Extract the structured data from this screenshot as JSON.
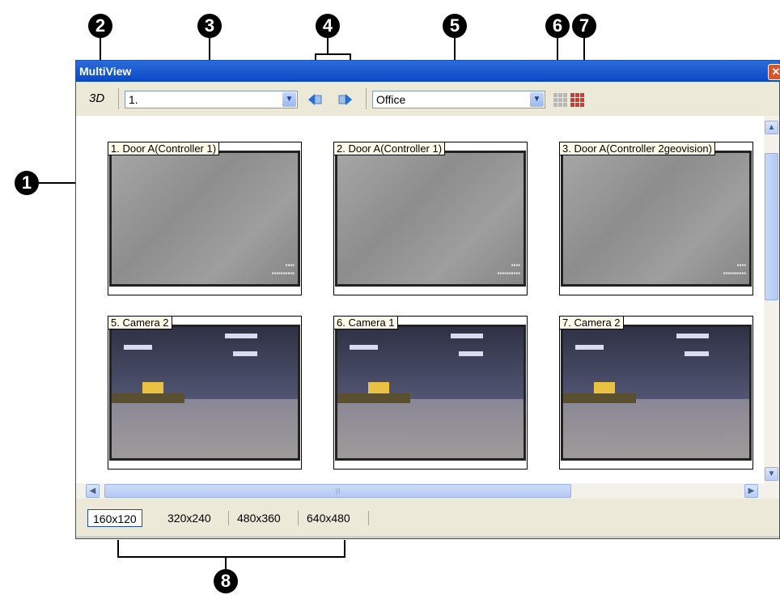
{
  "window": {
    "title": "MultiView",
    "close_glyph": "✕"
  },
  "toolbar": {
    "btn_3d_label": "3D",
    "camera_combo_value": "1.",
    "group_combo_value": "Office",
    "icons": [
      "prev-page-icon",
      "next-page-icon",
      "layout-grid-icon",
      "close-all-icon"
    ]
  },
  "tiles": [
    {
      "label": "1. Door A(Controller 1)",
      "scene": "door"
    },
    {
      "label": "2. Door A(Controller 1)",
      "scene": "door"
    },
    {
      "label": "3. Door A(Controller 2geovision)",
      "scene": "door"
    },
    {
      "label": "5. Camera 2",
      "scene": "office"
    },
    {
      "label": "6. Camera 1",
      "scene": "office"
    },
    {
      "label": "7. Camera 2",
      "scene": "office"
    }
  ],
  "resolutions": {
    "r160": "160x120",
    "r320": "320x240",
    "r480": "480x360",
    "r640": "640x480",
    "selected": "160x120"
  },
  "callouts": {
    "c1": "1",
    "c2": "2",
    "c3": "3",
    "c4": "4",
    "c5": "5",
    "c6": "6",
    "c7": "7",
    "c8": "8"
  },
  "colors": {
    "titlebar": "#0a49c6",
    "selection_border": "#1f4fa8",
    "close_red": "#d9532b"
  }
}
